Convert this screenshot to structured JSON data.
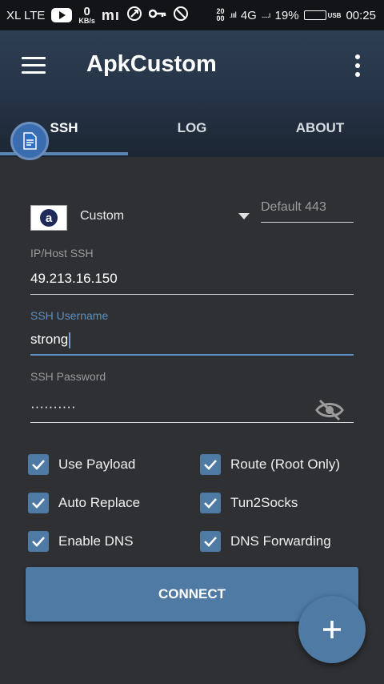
{
  "status_bar": {
    "carrier": "XL LTE",
    "speed_value": "0",
    "speed_unit": "KB/s",
    "mi_label": "mı",
    "signal_top": "20",
    "signal_bottom": "00",
    "network": "4G",
    "battery_percent": "19%",
    "usb_label": "USB",
    "time": "00:25",
    "battery_level": 0.19,
    "battery_color": "#3fd04a"
  },
  "app_bar": {
    "title": "ApkCustom",
    "menu_icon": "hamburger-menu-icon",
    "overflow_icon": "more-vert-icon"
  },
  "tabs": [
    {
      "label": "SSH",
      "active": true
    },
    {
      "label": "LOG",
      "active": false
    },
    {
      "label": "ABOUT",
      "active": false
    }
  ],
  "server": {
    "logo_letter": "a",
    "selected": "Custom",
    "port_placeholder": "Default 443"
  },
  "fields": {
    "host": {
      "label": "IP/Host SSH",
      "value": "49.213.16.150"
    },
    "username": {
      "label": "SSH Username",
      "value": "strong"
    },
    "password": {
      "label": "SSH Password",
      "value": "··········"
    }
  },
  "checkboxes": [
    {
      "label": "Use Payload",
      "checked": true
    },
    {
      "label": "Route (Root Only)",
      "checked": true
    },
    {
      "label": "Auto Replace",
      "checked": true
    },
    {
      "label": "Tun2Socks",
      "checked": true
    },
    {
      "label": "Enable DNS",
      "checked": true
    },
    {
      "label": "DNS Forwarding",
      "checked": true
    }
  ],
  "connect_label": "CONNECT",
  "fab_icon": "plus-icon",
  "colors": {
    "accent": "#4f7aa4",
    "focus": "#5f8fc0",
    "background": "#2f3033",
    "appbar": "#2e3e52"
  }
}
